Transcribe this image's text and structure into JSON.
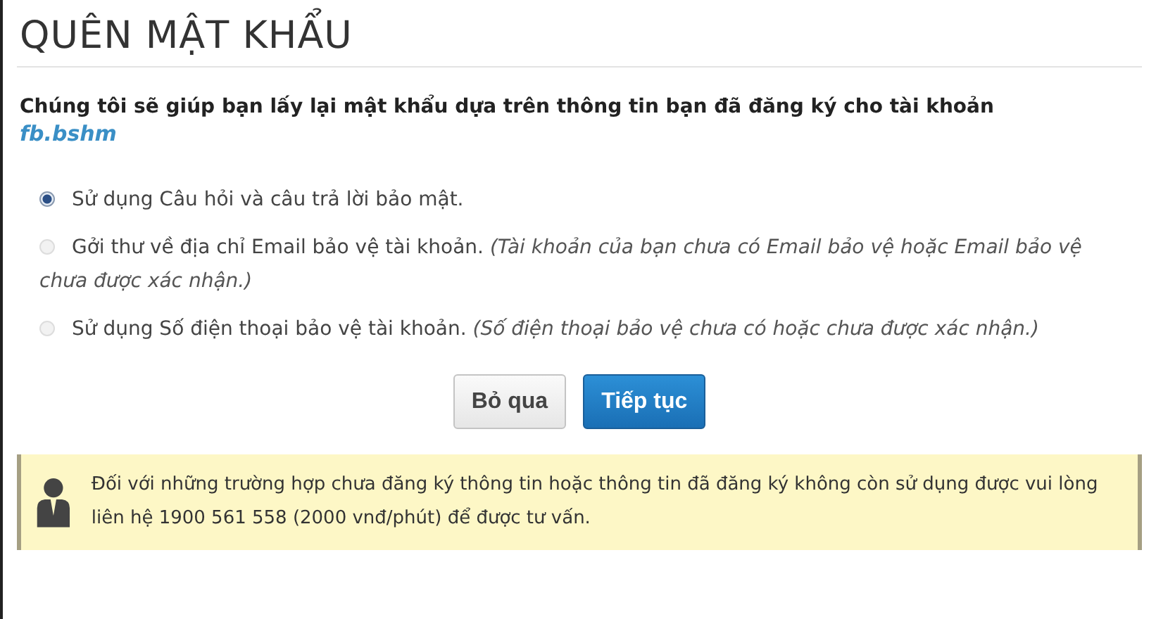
{
  "title": "QUÊN MẬT KHẨU",
  "intro": "Chúng tôi sẽ giúp bạn lấy lại mật khẩu dựa trên thông tin bạn đã đăng ký cho tài khoản",
  "account": "fb.bshm",
  "options": [
    {
      "label": "Sử dụng Câu hỏi và câu trả lời bảo mật.",
      "selected": true,
      "disabled": false
    },
    {
      "label": "Gởi thư về địa chỉ Email bảo vệ tài khoản.",
      "note": "(Tài khoản của bạn chưa có Email bảo vệ hoặc Email bảo vệ chưa được xác nhận.)",
      "selected": false,
      "disabled": true
    },
    {
      "label": "Sử dụng Số điện thoại bảo vệ tài khoản.",
      "note": "(Số điện thoại bảo vệ chưa có hoặc chưa được xác nhận.)",
      "selected": false,
      "disabled": true
    }
  ],
  "buttons": [
    {
      "label": "Bỏ qua",
      "kind": "secondary"
    },
    {
      "label": "Tiếp tục",
      "kind": "primary"
    }
  ],
  "notice": "Đối với những trường hợp chưa đăng ký thông tin hoặc thông tin đã đăng ký không còn sử dụng được vui lòng liên hệ 1900 561 558 (2000 vnđ/phút) để được tư vấn."
}
